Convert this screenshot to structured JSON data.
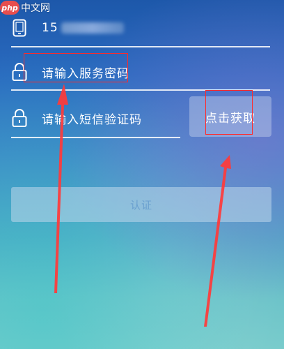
{
  "watermark": {
    "logo": "php",
    "text": "中文网"
  },
  "phone": {
    "value_prefix": "15",
    "icon": "phone-icon"
  },
  "password": {
    "placeholder": "请输入服务密码",
    "icon": "lock-icon"
  },
  "sms": {
    "placeholder": "请输入短信验证码",
    "icon": "lock-icon",
    "get_code_label": "点击获取"
  },
  "submit": {
    "label": "认证"
  },
  "colors": {
    "annotation": "#ff2a2a",
    "text": "#ffffff",
    "submit_text": "#6aa0cf"
  }
}
